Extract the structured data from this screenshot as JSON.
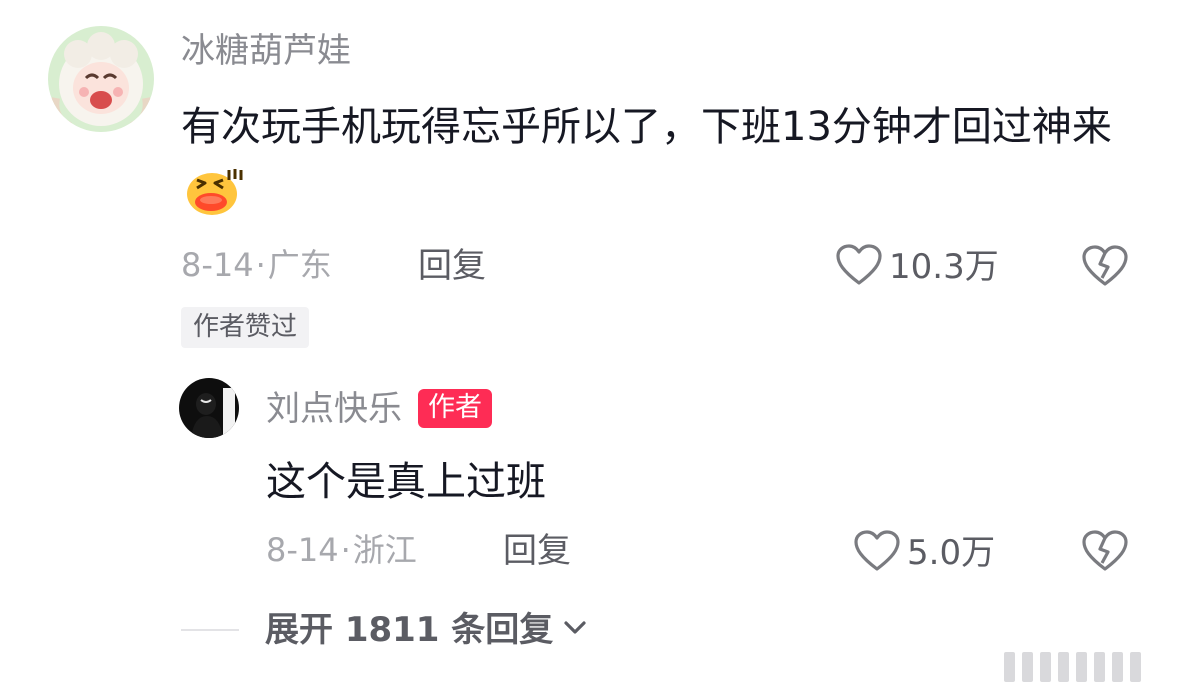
{
  "comment": {
    "username": "冰糖葫芦娃",
    "text": "有次玩手机玩得忘乎所以了，下班13分钟才回过神来",
    "emoji_icon": "laughing-emoji-icon",
    "date": "8-14",
    "separator": "·",
    "location": "广东",
    "reply_label": "回复",
    "likes": "10.3万",
    "author_liked_label": "作者赞过"
  },
  "reply": {
    "username": "刘点快乐",
    "author_tag": "作者",
    "text": "这个是真上过班",
    "date": "8-14",
    "separator": "·",
    "location": "浙江",
    "reply_label": "回复",
    "likes": "5.0万"
  },
  "expand": {
    "label": "展开 1811 条回复"
  },
  "colors": {
    "author_tag": "#fe2c55",
    "username": "#8a8b91",
    "meta": "#a7a8ad",
    "text": "#161823"
  }
}
